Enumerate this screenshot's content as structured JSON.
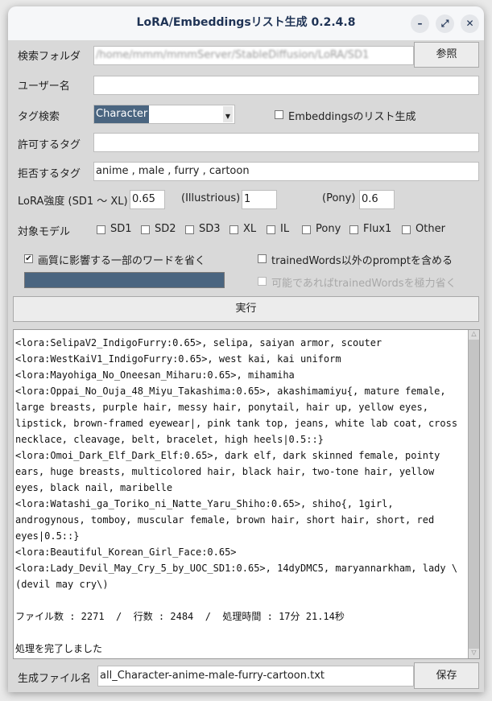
{
  "window": {
    "title": "LoRA/Embeddingsリスト生成 0.2.4.8",
    "minimize": "–",
    "maximize": "⤢",
    "close": "✕"
  },
  "folder": {
    "label": "検索フォルダ",
    "value": "/home/mmm/mmmServer/StableDiffusion/LoRA/SD1",
    "browse": "参照"
  },
  "user": {
    "label": "ユーザー名",
    "value": ""
  },
  "tag_search": {
    "label": "タグ検索",
    "selected": "Character",
    "embeddings_label": "Embeddingsのリスト生成",
    "embeddings_checked": false
  },
  "allow": {
    "label": "許可するタグ",
    "value": ""
  },
  "deny": {
    "label": "拒否するタグ",
    "value": "anime , male , furry , cartoon"
  },
  "strength": {
    "label": "LoRA強度  (SD1 〜 XL)",
    "sd": "0.65",
    "il_label": "(Illustrious)",
    "il": "1",
    "pony_label": "(Pony)",
    "pony": "0.6"
  },
  "models": {
    "label": "対象モデル",
    "items": [
      "SD1",
      "SD2",
      "SD3",
      "XL",
      "IL",
      "Pony",
      "Flux1",
      "Other"
    ]
  },
  "options": {
    "omit_quality": "画質に影響する一部のワードを省く",
    "omit_quality_checked": true,
    "include_prompt": "trainedWords以外のpromptを含める",
    "omit_trained": "可能であればtrainedWordsを極力省く"
  },
  "progress": {
    "percent": 100
  },
  "run": "実行",
  "output": "<lora:SelipaV2_IndigoFurry:0.65>, selipa, saiyan armor, scouter\n<lora:WestKaiV1_IndigoFurry:0.65>, west kai, kai uniform\n<lora:Mayohiga_No_Oneesan_Miharu:0.65>, mihamiha\n<lora:Oppai_No_Ouja_48_Miyu_Takashima:0.65>, akashimamiyu{, mature female, large breasts, purple hair, messy hair, ponytail, hair up, yellow eyes, lipstick, brown-framed eyewear|, pink tank top, jeans, white lab coat, cross necklace, cleavage, belt, bracelet, high heels|0.5::}\n<lora:Omoi_Dark_Elf_Dark_Elf:0.65>, dark elf, dark skinned female, pointy ears, huge breasts, multicolored hair, black hair, two-tone hair, yellow eyes, black nail, maribelle\n<lora:Watashi_ga_Toriko_ni_Natte_Yaru_Shiho:0.65>, shiho{, 1girl, androgynous, tomboy, muscular female, brown hair, short hair, short, red eyes|0.5::}\n<lora:Beautiful_Korean_Girl_Face:0.65>\n<lora:Lady_Devil_May_Cry_5_by_UOC_SD1:0.65>, 14dyDMC5, maryannarkham, lady \\(devil may cry\\)\n\nファイル数 : 2271  /  行数 : 2484  /  処理時間 : 17分 21.14秒\n\n処理を完了しました",
  "save": {
    "label": "生成ファイル名",
    "value": "all_Character-anime-male-furry-cartoon.txt",
    "button": "保存"
  },
  "colors": {
    "accent": "#4a6580",
    "title": "#1f3355"
  }
}
